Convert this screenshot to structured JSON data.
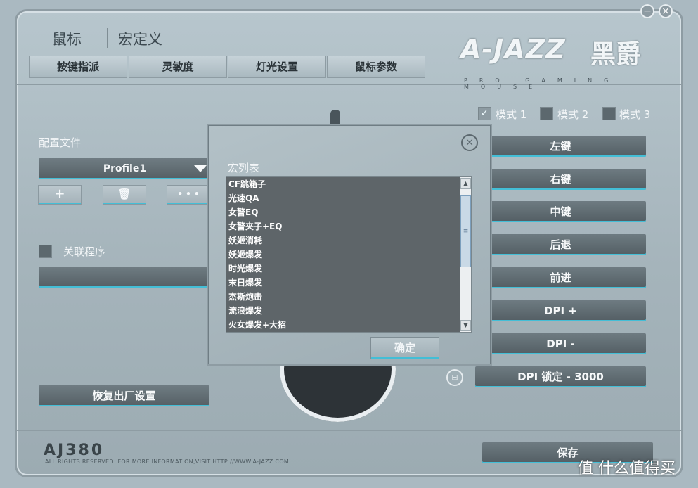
{
  "window": {
    "minimize_icon": "minus-icon",
    "close_icon": "close-icon",
    "minimize_glyph": "−",
    "close_glyph": "×"
  },
  "top_tabs": [
    "鼠标",
    "宏定义"
  ],
  "sub_tabs": [
    "按键指派",
    "灵敏度",
    "灯光设置",
    "鼠标参数"
  ],
  "brand": {
    "logo": "A-JAZZ",
    "logo_cn": "黑爵",
    "tagline": "PRO GAMING MOUSE"
  },
  "profile": {
    "label": "配置文件",
    "selected": "Profile1",
    "add_glyph": "+",
    "delete_glyph": "🗑",
    "more_glyph": "• • •"
  },
  "linked_program": {
    "label": "关联程序",
    "value": ""
  },
  "reset_button": "恢复出厂设置",
  "modes": [
    {
      "label": "模式 1",
      "checked": true
    },
    {
      "label": "模式 2",
      "checked": false
    },
    {
      "label": "模式 3",
      "checked": false
    }
  ],
  "buttons": [
    "左键",
    "右键",
    "中键",
    "后退",
    "前进",
    "DPI +",
    "DPI -",
    "DPI 锁定 - 3000"
  ],
  "save_button": "保存",
  "footer": {
    "model": "AJ380",
    "copyright": "ALL RIGHTS RESERVED. FOR MORE INFORMATION,VISIT HTTP://WWW.A-JAZZ.COM"
  },
  "dialog": {
    "title": "宏列表",
    "close_glyph": "×",
    "items": [
      "CF跳箱子",
      "光速QA",
      "女警EQ",
      "女警夹子+EQ",
      "妖姬消耗",
      "妖姬爆发",
      "时光爆发",
      "末日爆发",
      "杰斯炮击",
      "流浪爆发",
      "火女爆发+大招"
    ],
    "ok_button": "确定"
  },
  "watermark": "值 什么值得买",
  "colors": {
    "accent": "#43bed6",
    "panel": "#aab9c1",
    "dark_button": "#5e6a70"
  }
}
